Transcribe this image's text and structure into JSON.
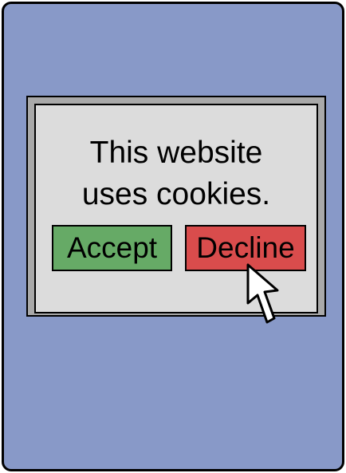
{
  "dialog": {
    "message_line1": "This website",
    "message_line2": "uses cookies.",
    "accept_label": "Accept",
    "decline_label": "Decline"
  },
  "colors": {
    "screen_background": "#8899c8",
    "dialog_frame": "#a9a9a9",
    "dialog_panel": "#dcdcdc",
    "accept_button": "#66aa66",
    "decline_button": "#d94c4c"
  },
  "cursor": {
    "icon": "arrow-cursor-icon",
    "hovering": "decline-button"
  }
}
